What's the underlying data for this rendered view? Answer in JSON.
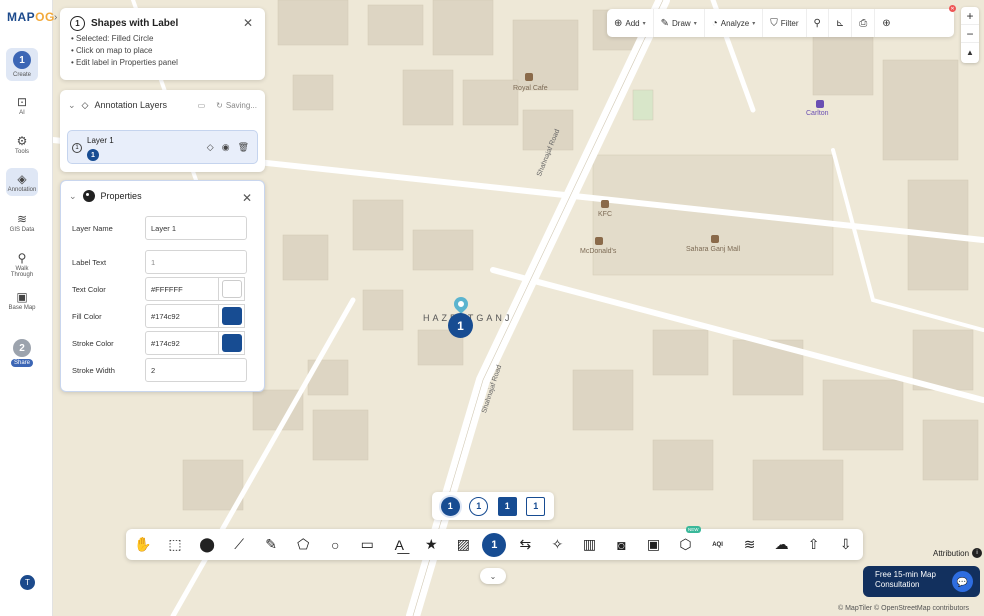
{
  "app": {
    "logo_main": "MAP",
    "logo_accent": "OG"
  },
  "sidebar": {
    "items": [
      {
        "label": "Create",
        "step": "1"
      },
      {
        "label": "AI"
      },
      {
        "label": "Tools"
      },
      {
        "label": "Annotation"
      },
      {
        "label": "GIS Data"
      },
      {
        "label": "Walk Through"
      },
      {
        "label": "Base Map"
      },
      {
        "label": "Share",
        "step": "2"
      }
    ],
    "avatar_initial": "T"
  },
  "shapes_panel": {
    "step": "1",
    "title": "Shapes with Label",
    "lines": [
      "• Selected: Filled Circle",
      "• Click on map to place",
      "• Edit label in Properties panel"
    ]
  },
  "layers_panel": {
    "title": "Annotation Layers",
    "status": "Saving...",
    "layer_name": "Layer 1",
    "layer_badge": "1"
  },
  "properties": {
    "title": "Properties",
    "fields": {
      "layer_name_label": "Layer Name",
      "layer_name": "Layer 1",
      "label_text_label": "Label Text",
      "label_text": "1",
      "text_color_label": "Text Color",
      "text_color": "#FFFFFF",
      "fill_color_label": "Fill Color",
      "fill_color": "#174c92",
      "stroke_color_label": "Stroke Color",
      "stroke_color": "#174c92",
      "stroke_width_label": "Stroke Width",
      "stroke_width": "2"
    }
  },
  "top_toolbar": {
    "add": "Add",
    "draw": "Draw",
    "analyze": "Analyze",
    "filter": "Filter"
  },
  "map": {
    "labels": {
      "royal_cafe": "Royal Cafe",
      "carlton": "Carlton",
      "kfc": "KFC",
      "mcdonalds": "McDonald's",
      "sahara_mall": "Sahara Ganj Mall",
      "area": "HAZRATGANJ",
      "road_1": "Shahnajaf Road",
      "road_2": "Shahnajaf Road"
    },
    "marker_label": "1"
  },
  "shape_selector": {
    "items": [
      "1",
      "1",
      "1",
      "1"
    ]
  },
  "bottom_toolbar": {
    "active_label": "1",
    "new_badge": "NEW",
    "aqi_label": "AQI"
  },
  "footer": {
    "attribution": "Attribution",
    "consult_line1": "Free 15-min Map",
    "consult_line2": "Consultation",
    "copyright": "© MapTiler © OpenStreetMap contributors"
  },
  "colors": {
    "brand": "#174c92",
    "accent": "#f2a93b",
    "map_bg": "#eee8d7",
    "building": "#ded6c4"
  }
}
